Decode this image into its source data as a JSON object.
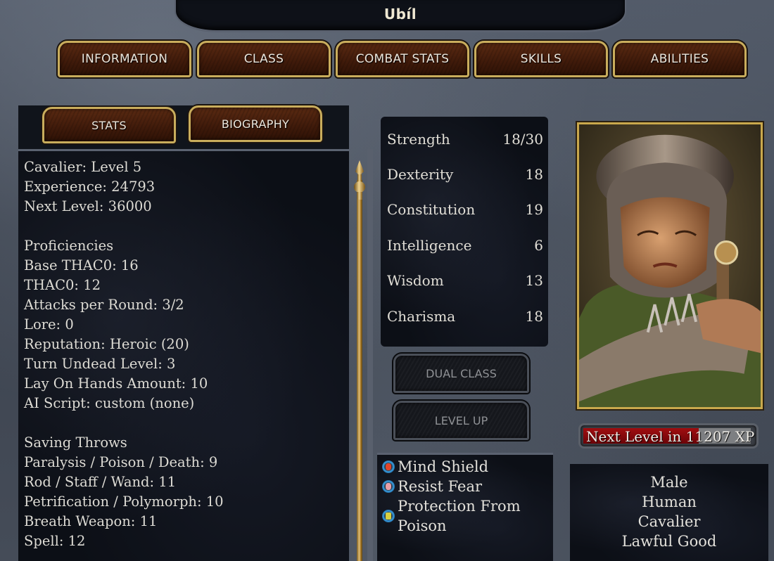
{
  "window": {
    "title": "Ubíl"
  },
  "main_tabs": [
    {
      "label": "INFORMATION"
    },
    {
      "label": "CLASS"
    },
    {
      "label": "COMBAT STATS"
    },
    {
      "label": "SKILLS"
    },
    {
      "label": "ABILITIES"
    }
  ],
  "sub_tabs": [
    {
      "label": "STATS"
    },
    {
      "label": "BIOGRAPHY"
    }
  ],
  "stats_lines": [
    "Cavalier: Level 5",
    "Experience: 24793",
    "Next Level: 36000",
    "",
    "Proficiencies",
    "Base THAC0: 16",
    "THAC0: 12",
    "Attacks per Round: 3/2",
    "Lore: 0",
    "Reputation: Heroic (20)",
    "Turn Undead Level: 3",
    "Lay On Hands Amount: 10",
    "AI Script: custom (none)",
    "",
    "Saving Throws",
    "Paralysis / Poison / Death: 9",
    "Rod / Staff / Wand: 11",
    "Petrification / Polymorph: 10",
    "Breath Weapon: 11",
    "Spell: 12"
  ],
  "abilities": [
    {
      "name": "Strength",
      "value": "18/30"
    },
    {
      "name": "Dexterity",
      "value": "18"
    },
    {
      "name": "Constitution",
      "value": "19"
    },
    {
      "name": "Intelligence",
      "value": "6"
    },
    {
      "name": "Wisdom",
      "value": "13"
    },
    {
      "name": "Charisma",
      "value": "18"
    }
  ],
  "buttons": {
    "dual_class": "DUAL CLASS",
    "level_up": "LEVEL UP"
  },
  "effects": [
    {
      "name": "Mind Shield",
      "icon": "mind-shield-icon",
      "color": "#e0452a"
    },
    {
      "name": "Resist Fear",
      "icon": "resist-fear-icon",
      "color": "#e8a0a8"
    },
    {
      "name_line1": "Protection From",
      "name_line2": "Poison",
      "icon": "protection-from-poison-icon",
      "color": "#d8d040"
    }
  ],
  "xp_bar": {
    "text": "Next Level in 11207 XP",
    "progress_fraction": 0.689,
    "fill_color": "#a00e10"
  },
  "bio": {
    "gender": "Male",
    "race": "Human",
    "class": "Cavalier",
    "alignment": "Lawful Good"
  }
}
